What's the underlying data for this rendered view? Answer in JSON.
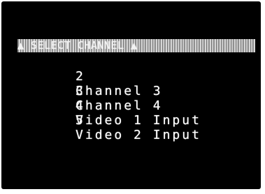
{
  "menu": {
    "header": "▲ SELECT CHANNEL ▲",
    "items": [
      {
        "number": "2",
        "label": "Channel 3"
      },
      {
        "number": "3",
        "label": "Channel 4"
      },
      {
        "number": "4",
        "label": "Video 1 Input"
      },
      {
        "number": "5",
        "label": "Video 2 Input"
      }
    ]
  }
}
